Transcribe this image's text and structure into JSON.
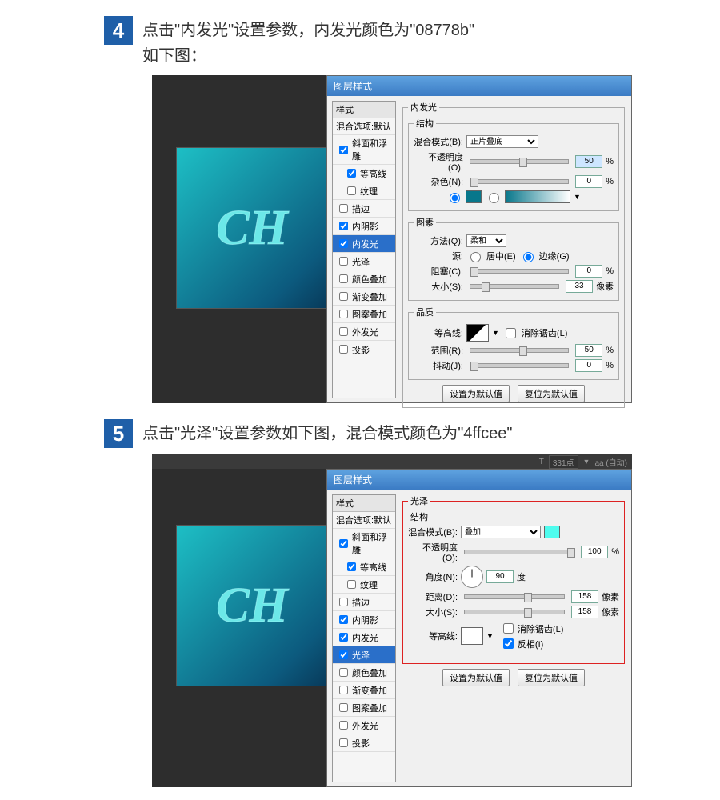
{
  "steps": {
    "s4": {
      "num": "4",
      "text_line1": "点击\"内发光\"设置参数，内发光颜色为\"08778b\"",
      "text_line2": "如下图："
    },
    "s5": {
      "num": "5",
      "text_line1": "点击\"光泽\"设置参数如下图，混合模式颜色为\"4ffcee\""
    }
  },
  "dialog_title": "图层样式",
  "styles_panel": {
    "header": "样式",
    "blend_opts": "混合选项:默认",
    "items": [
      "斜面和浮雕",
      "等高线",
      "纹理",
      "描边",
      "内阴影",
      "内发光",
      "光泽",
      "颜色叠加",
      "渐变叠加",
      "图案叠加",
      "外发光",
      "投影"
    ]
  },
  "panel4": {
    "group_title": "内发光",
    "section_struct": "结构",
    "blend_mode_label": "混合模式(B):",
    "blend_mode_value": "正片叠底",
    "opacity_label": "不透明度(O):",
    "opacity_value": "50",
    "noise_label": "杂色(N):",
    "noise_value": "0",
    "pct": "%",
    "color_hex": "#08778b",
    "section_elem": "图素",
    "method_label": "方法(Q):",
    "method_value": "柔和",
    "source_label": "源:",
    "source_center": "居中(E)",
    "source_edge": "边缘(G)",
    "choke_label": "阻塞(C):",
    "choke_value": "0",
    "size_label": "大小(S):",
    "size_value": "33",
    "px": "像素",
    "section_quality": "品质",
    "contour_label": "等高线:",
    "antialias_label": "消除锯齿(L)",
    "range_label": "范围(R):",
    "range_value": "50",
    "jitter_label": "抖动(J):",
    "jitter_value": "0",
    "btn_default": "设置为默认值",
    "btn_reset": "复位为默认值"
  },
  "panel5": {
    "group_title": "光泽",
    "section_struct": "结构",
    "blend_mode_label": "混合模式(B):",
    "blend_mode_value": "叠加",
    "swatch_color": "#4ffcee",
    "opacity_label": "不透明度(O):",
    "opacity_value": "100",
    "pct": "%",
    "angle_label": "角度(N):",
    "angle_value": "90",
    "deg": "度",
    "distance_label": "距离(D):",
    "distance_value": "158",
    "size_label": "大小(S):",
    "size_value": "158",
    "px": "像素",
    "contour_label": "等高线:",
    "antialias_label": "消除锯齿(L)",
    "invert_label": "反相(I)",
    "btn_default": "设置为默认值",
    "btn_reset": "复位为默认值",
    "topstrip_pt": "331点",
    "topstrip_aa": "aa (自动)"
  },
  "preview_text": "CH"
}
